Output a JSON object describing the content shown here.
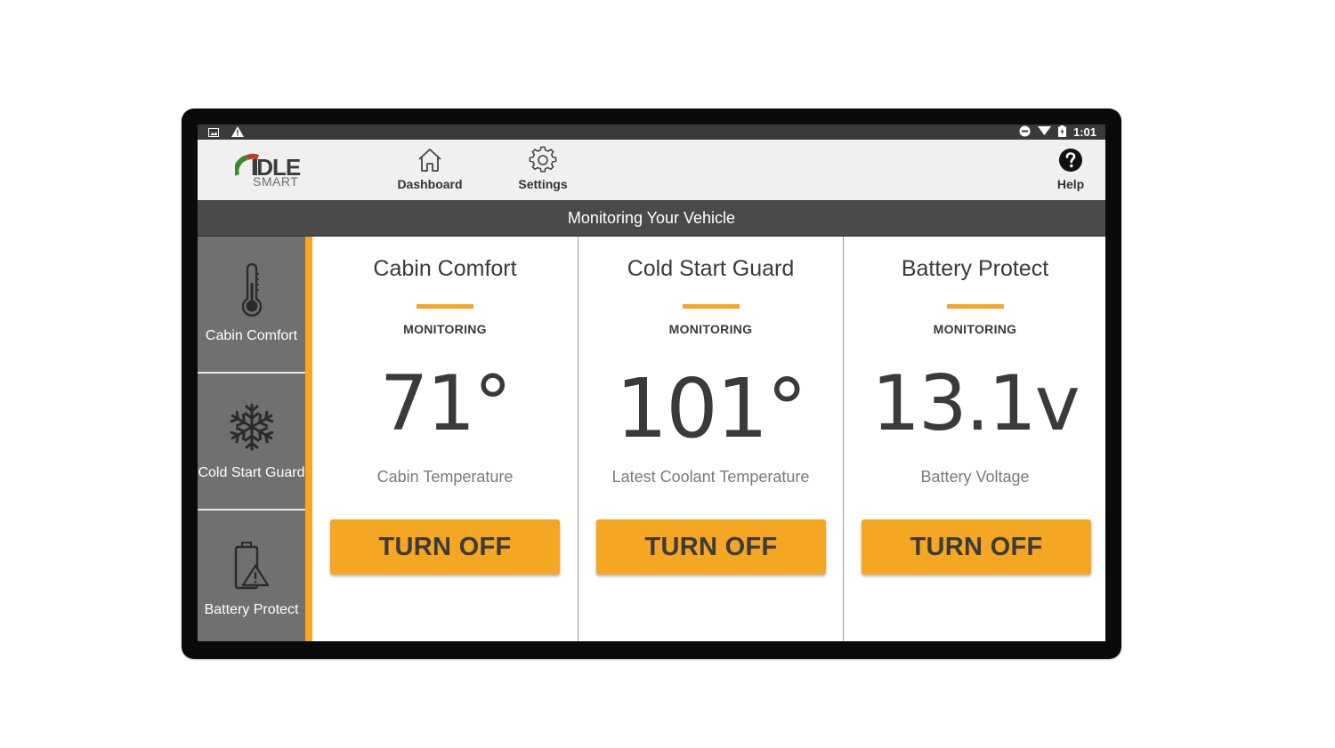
{
  "statusbar": {
    "time": "1:01"
  },
  "brand": {
    "word1": "IDLE",
    "word2": "SMART"
  },
  "nav": {
    "dashboard": "Dashboard",
    "settings": "Settings",
    "help": "Help"
  },
  "page_title": "Monitoring Your Vehicle",
  "sidebar": {
    "items": [
      {
        "label": "Cabin Comfort",
        "icon": "thermometer-icon"
      },
      {
        "label": "Cold Start Guard",
        "icon": "snowflake-icon"
      },
      {
        "label": "Battery Protect",
        "icon": "battery-warning-icon"
      }
    ]
  },
  "cards": [
    {
      "title": "Cabin Comfort",
      "status": "MONITORING",
      "value": "71°",
      "caption": "Cabin Temperature",
      "button": "TURN OFF"
    },
    {
      "title": "Cold Start Guard",
      "status": "MONITORING",
      "value": "101°",
      "caption": "Latest Coolant Temperature",
      "button": "TURN OFF"
    },
    {
      "title": "Battery Protect",
      "status": "MONITORING",
      "value": "13.1v",
      "caption": "Battery Voltage",
      "button": "TURN OFF"
    }
  ],
  "colors": {
    "accent": "#f5a623",
    "sidebar": "#707070",
    "titlebar": "#4a4a4a",
    "text": "#3a3a3a"
  }
}
